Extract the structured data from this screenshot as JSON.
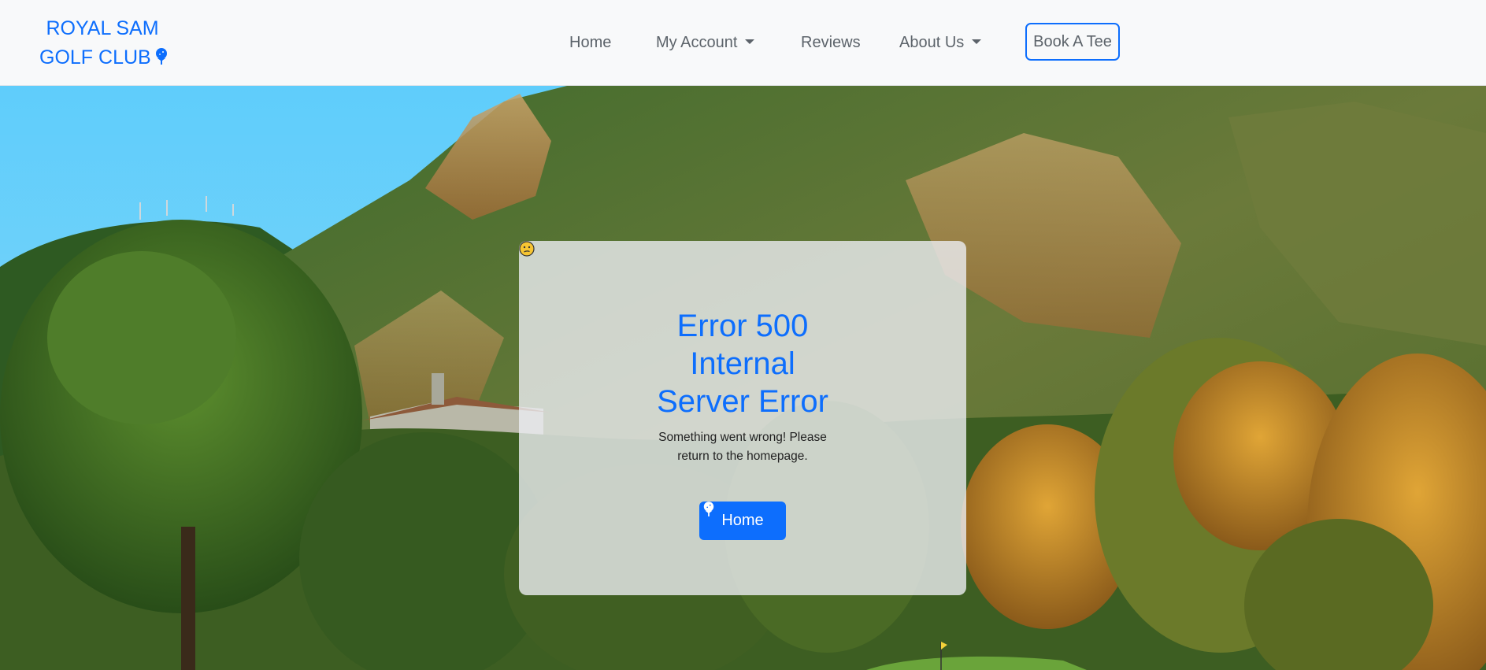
{
  "brand": {
    "line1": "ROYAL SAM",
    "line2": "GOLF CLUB",
    "icon": "golf-tee-icon"
  },
  "nav": {
    "items": [
      {
        "label": "Home",
        "dropdown": false
      },
      {
        "label": "My Account",
        "dropdown": true
      },
      {
        "label": "Reviews",
        "dropdown": false
      },
      {
        "label": "About Us",
        "dropdown": true
      }
    ],
    "cta_label": "Book A Tee"
  },
  "hero": {
    "background": "mountain-golf-course-photo"
  },
  "error": {
    "emoji": "confused-face-icon",
    "title_lines": [
      "Error 500",
      "Internal",
      "Server Error"
    ],
    "message_lines": [
      "Something went wrong! Please",
      "return to the homepage."
    ],
    "button_label": "Home",
    "button_icon": "golf-tee-icon"
  },
  "colors": {
    "accent": "#0d6efd",
    "nav_text": "#5c636a",
    "navbar_bg": "#f8f9fa",
    "card_bg": "rgba(236,238,242,0.80)"
  }
}
